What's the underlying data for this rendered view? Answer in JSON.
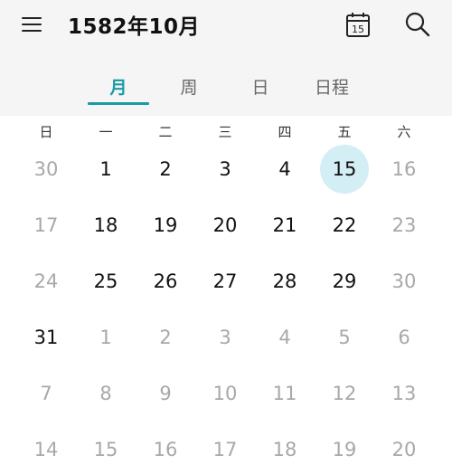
{
  "header": {
    "title": "1582年10月",
    "today_badge": "15"
  },
  "tabs": [
    {
      "label": "月",
      "active": true
    },
    {
      "label": "周",
      "active": false
    },
    {
      "label": "日",
      "active": false
    },
    {
      "label": "日程",
      "active": false
    }
  ],
  "weekdays": [
    "日",
    "一",
    "二",
    "三",
    "四",
    "五",
    "六"
  ],
  "weeks": [
    [
      {
        "d": "30",
        "cur": false
      },
      {
        "d": "1",
        "cur": true
      },
      {
        "d": "2",
        "cur": true
      },
      {
        "d": "3",
        "cur": true
      },
      {
        "d": "4",
        "cur": true
      },
      {
        "d": "15",
        "cur": true,
        "today": true
      },
      {
        "d": "16",
        "cur": false
      }
    ],
    [
      {
        "d": "17",
        "cur": false
      },
      {
        "d": "18",
        "cur": true
      },
      {
        "d": "19",
        "cur": true
      },
      {
        "d": "20",
        "cur": true
      },
      {
        "d": "21",
        "cur": true
      },
      {
        "d": "22",
        "cur": true
      },
      {
        "d": "23",
        "cur": false
      }
    ],
    [
      {
        "d": "24",
        "cur": false
      },
      {
        "d": "25",
        "cur": true
      },
      {
        "d": "26",
        "cur": true
      },
      {
        "d": "27",
        "cur": true
      },
      {
        "d": "28",
        "cur": true
      },
      {
        "d": "29",
        "cur": true
      },
      {
        "d": "30",
        "cur": false
      }
    ],
    [
      {
        "d": "31",
        "cur": true
      },
      {
        "d": "1",
        "cur": false
      },
      {
        "d": "2",
        "cur": false
      },
      {
        "d": "3",
        "cur": false
      },
      {
        "d": "4",
        "cur": false
      },
      {
        "d": "5",
        "cur": false
      },
      {
        "d": "6",
        "cur": false
      }
    ],
    [
      {
        "d": "7",
        "cur": false
      },
      {
        "d": "8",
        "cur": false
      },
      {
        "d": "9",
        "cur": false
      },
      {
        "d": "10",
        "cur": false
      },
      {
        "d": "11",
        "cur": false
      },
      {
        "d": "12",
        "cur": false
      },
      {
        "d": "13",
        "cur": false
      }
    ],
    [
      {
        "d": "14",
        "cur": false
      },
      {
        "d": "15",
        "cur": false
      },
      {
        "d": "16",
        "cur": false
      },
      {
        "d": "17",
        "cur": false
      },
      {
        "d": "18",
        "cur": false
      },
      {
        "d": "19",
        "cur": false
      },
      {
        "d": "20",
        "cur": false
      }
    ]
  ],
  "colors": {
    "accent": "#1a9aa8",
    "today_bg": "#d3eef5",
    "muted_day": "#a8a8a8",
    "header_bg": "#f5f5f5"
  },
  "icons": [
    "menu-icon",
    "calendar-today-icon",
    "search-icon"
  ]
}
